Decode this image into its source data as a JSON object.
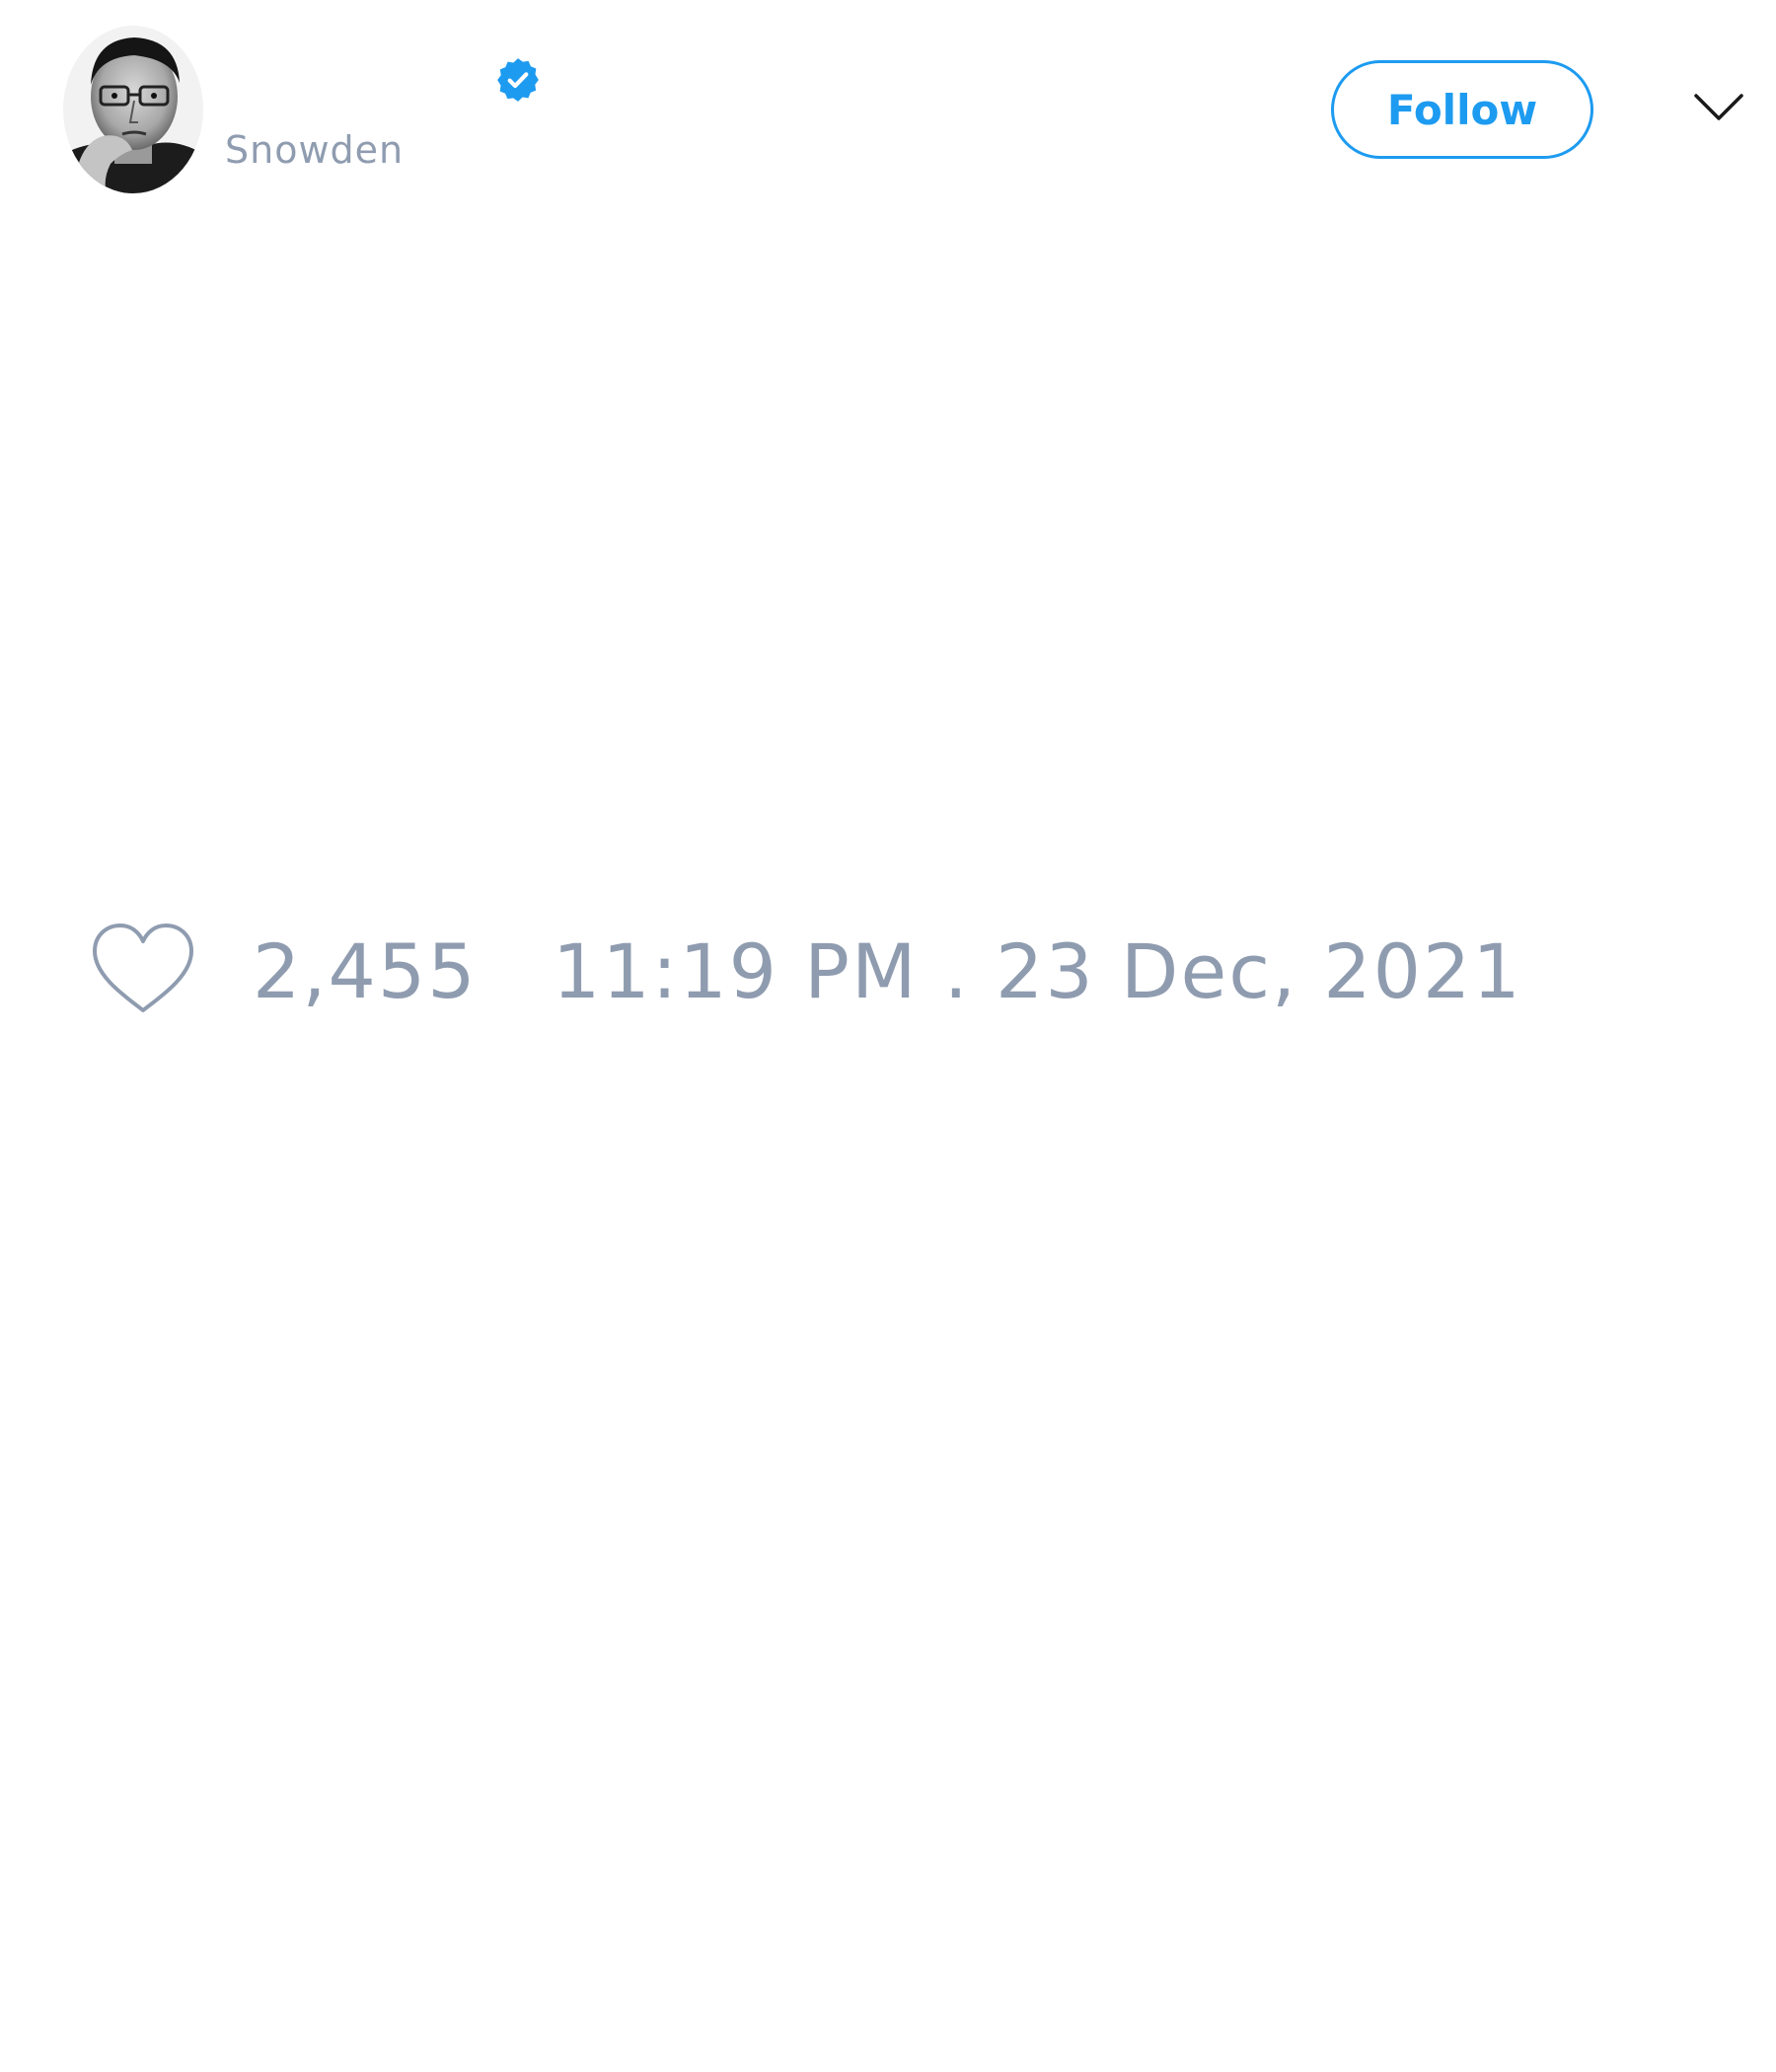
{
  "tweet": {
    "author": {
      "handle": "Snowden",
      "verified": true,
      "avatar_icon": "portrait-photo"
    },
    "follow_label": "Follow",
    "more_icon": "chevron-down-icon",
    "like_icon": "heart-outline-icon",
    "like_count": "2,455",
    "timestamp": "11:19 PM . 23 Dec, 2021"
  },
  "colors": {
    "accent": "#1d9bf0",
    "muted_text": "#8f9cb0",
    "background": "#ffffff"
  }
}
